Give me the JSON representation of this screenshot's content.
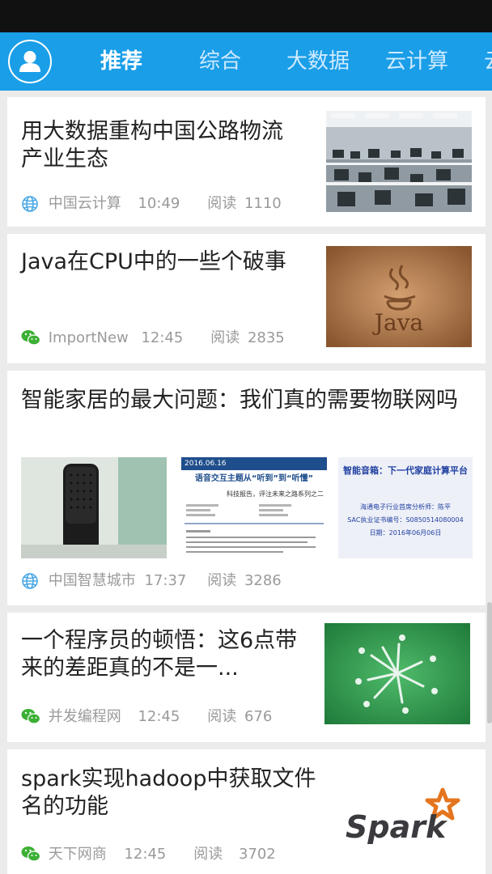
{
  "tabs": [
    {
      "label": "推荐",
      "active": true
    },
    {
      "label": "综合",
      "active": false
    },
    {
      "label": "大数据",
      "active": false
    },
    {
      "label": "云计算",
      "active": false
    },
    {
      "label": "云",
      "active": false
    }
  ],
  "articles": [
    {
      "title": "用大数据重构中国公路物流产业生态",
      "source": "中国云计算",
      "source_icon": "globe-icon",
      "time": "10:49",
      "reads_label": "阅读",
      "reads": "1110"
    },
    {
      "title": "Java在CPU中的一些个破事",
      "source": "ImportNew",
      "source_icon": "wechat-icon",
      "time": "12:45",
      "reads_label": "阅读",
      "reads": "2835",
      "thumb_text": "Java"
    },
    {
      "title": "智能家居的最大问题：我们真的需要物联网吗",
      "source": "中国智慧城市",
      "source_icon": "globe-icon",
      "time": "17:37",
      "reads_label": "阅读",
      "reads": "3286",
      "thumb2_lines": [
        "2016.06.16",
        "语音交互主题从“听到”到“听懂”",
        "科技报告，评注未来之路系列之二"
      ],
      "thumb3_lines": [
        "智能音箱：下一代家庭计算平台",
        "海通电子行业首席分析师：陈平",
        "SAC执业证书编号：S0850514080004",
        "日期：2016年06月06日"
      ]
    },
    {
      "title": "一个程序员的顿悟：这6点带来的差距真的不是一...",
      "source": "并发编程网",
      "source_icon": "wechat-icon",
      "time": "12:45",
      "reads_label": "阅读",
      "reads": "676"
    },
    {
      "title": "spark实现hadoop中获取文件名的功能",
      "source": "天下网商",
      "source_icon": "wechat-icon",
      "time": "12:45",
      "reads_label": "阅读",
      "reads": "3702",
      "thumb_text": "Spark"
    }
  ],
  "colors": {
    "accent": "#1a9ee8",
    "globe": "#4aa8e6",
    "wechat": "#3cb034"
  }
}
